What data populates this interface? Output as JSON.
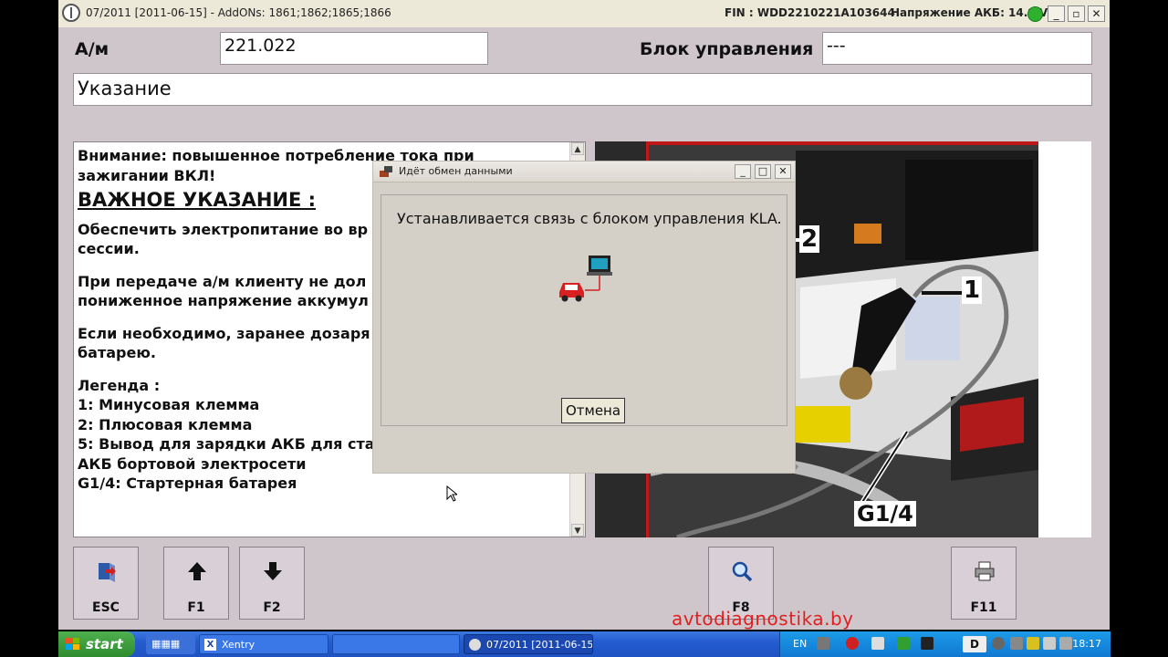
{
  "titlebar": {
    "title": "07/2011 [2011-06-15] - AddONs: 1861;1862;1865;1866",
    "fin": "FIN : WDD2210221A103644",
    "voltage": "Напряжение АКБ: 14.9 V"
  },
  "header": {
    "vehicle_label": "А/м",
    "vehicle_value": "221.022",
    "ecu_label": "Блок управления",
    "ecu_value": "---",
    "section_title": "Указание"
  },
  "note": {
    "warning_line1": "Внимание: повышенное потребление тока при",
    "warning_line2": "зажигании ВКЛ!",
    "heading": "ВАЖНОЕ УКАЗАНИЕ :",
    "p1_line1": "Обеспечить электропитание во вр",
    "p1_line2": "сессии.",
    "p2_line1": "При передаче а/м клиенту не дол",
    "p2_line2": "пониженное напряжение аккумул",
    "p3_line1": "Если необходимо, заранее дозаря",
    "p3_line2": "батарею.",
    "legend_title": "Легенда :",
    "legend_1": "1: Минусовая клемма",
    "legend_2": "2: Плюсовая клемма",
    "legend_5_line1": "5: Вывод для зарядки АКБ для стартерной батареи и",
    "legend_5_line2": "АКБ бортовой электросети",
    "legend_g": "G1/4: Стартерная батарея"
  },
  "photo": {
    "callout_1": "1",
    "callout_2": "2",
    "callout_g": "G1/4"
  },
  "dialog": {
    "title": "Идёт обмен данными",
    "message": "Устанавливается связь с блоком управления KLA.",
    "cancel_label": "Отмена"
  },
  "function_buttons": [
    {
      "label": "ESC",
      "icon": "exit-door-icon"
    },
    {
      "label": "F1",
      "icon": "arrow-up-icon"
    },
    {
      "label": "F2",
      "icon": "arrow-down-icon"
    },
    {
      "label": "F8",
      "icon": "magnifier-icon"
    },
    {
      "label": "F11",
      "icon": "printer-icon"
    }
  ],
  "watermark": "avtodiagnostika.by",
  "taskbar": {
    "start_label": "start",
    "task_xentry": "Xentry",
    "task_window": "07/2011 [2011-06-15...",
    "lang": "EN",
    "clock": "18:17",
    "d_label": "D"
  },
  "colors": {
    "app_bg": "#cfc6cc",
    "status_green": "#2fb02f",
    "watermark_red": "#e02020",
    "taskbar_blue": "#245ccf"
  }
}
